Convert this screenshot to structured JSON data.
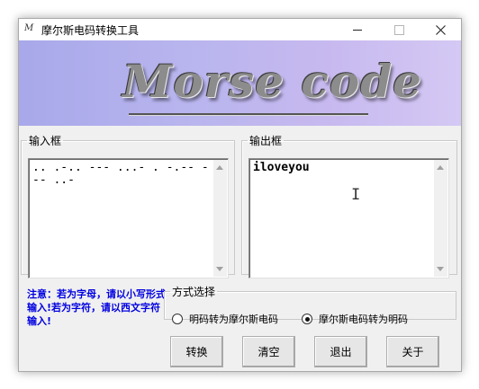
{
  "window": {
    "title": "摩尔斯电码转换工具",
    "icon_text": "M",
    "controls": [
      "minimize-icon",
      "maximize-icon",
      "close-icon"
    ]
  },
  "banner": {
    "logo_text": "Morse code"
  },
  "input": {
    "legend": "输入框",
    "value": ".. .-.. --- ...- . -.-- --- ..-"
  },
  "output": {
    "legend": "输出框",
    "value": "iloveyou"
  },
  "note": "注意：若为字母，请以小写形式输入!若为字符，请以西文字符输入!",
  "mode": {
    "legend": "方式选择",
    "options": [
      {
        "label": "明码转为摩尔斯电码",
        "selected": false
      },
      {
        "label": "摩尔斯电码转为明码",
        "selected": true
      }
    ]
  },
  "buttons": {
    "convert": "转换",
    "clear": "清空",
    "exit": "退出",
    "about": "关于"
  }
}
